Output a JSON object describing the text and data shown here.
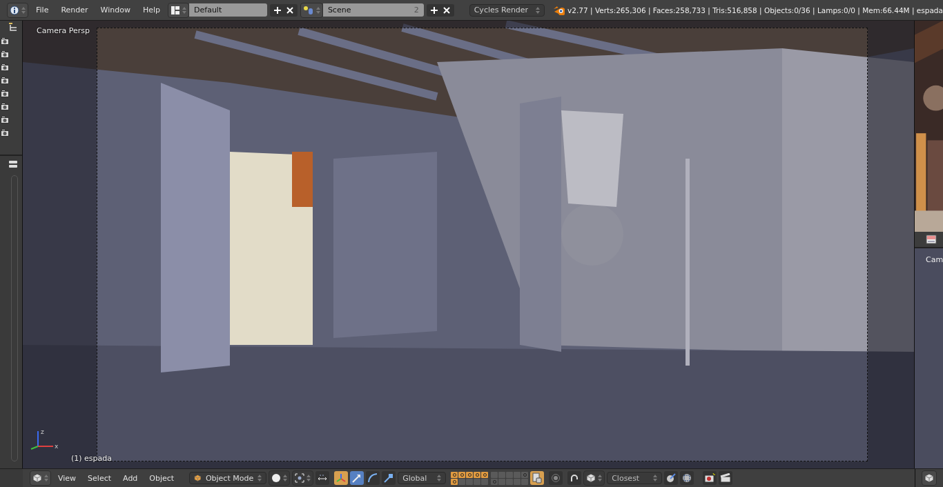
{
  "top_header": {
    "menus": [
      "File",
      "Render",
      "Window",
      "Help"
    ],
    "screen_layout": "Default",
    "scene": "Scene",
    "scene_users": "2",
    "render_engine": "Cycles Render",
    "stats": "v2.77 | Verts:265,306 | Faces:258,733 | Tris:516,858 | Objects:0/36 | Lamps:0/0 | Mem:66.44M | espada"
  },
  "viewport": {
    "view_name": "Camera Persp",
    "object_info": "(1) espada",
    "axis_labels": [
      "z",
      "x"
    ]
  },
  "view_header": {
    "menus": [
      "View",
      "Select",
      "Add",
      "Object"
    ],
    "mode": "Object Mode",
    "manipulator_enabled": true,
    "manipulators": [
      {
        "kind": "translate",
        "selected": true
      },
      {
        "kind": "rotate",
        "selected": false
      },
      {
        "kind": "scale",
        "selected": false
      }
    ],
    "orientation": "Global",
    "layers": [
      {
        "on": true,
        "used": true
      },
      {
        "on": true,
        "used": true
      },
      {
        "on": true,
        "used": true
      },
      {
        "on": true,
        "used": true
      },
      {
        "on": true,
        "used": true
      },
      {
        "on": true,
        "used": true
      },
      {
        "on": false,
        "used": false
      },
      {
        "on": false,
        "used": false
      },
      {
        "on": false,
        "used": false
      },
      {
        "on": false,
        "used": false
      },
      {
        "on": false,
        "used": false
      },
      {
        "on": false,
        "used": false
      },
      {
        "on": false,
        "used": false
      },
      {
        "on": false,
        "used": false
      },
      {
        "on": false,
        "used": true
      },
      {
        "on": false,
        "used": true
      },
      {
        "on": false,
        "used": false
      },
      {
        "on": false,
        "used": false
      },
      {
        "on": false,
        "used": false
      },
      {
        "on": false,
        "used": false
      }
    ],
    "lock_layers": true,
    "proportional_editing": false,
    "snap": false,
    "snap_target": "Closest"
  },
  "right_viewport": {
    "view_name": "Cam"
  }
}
